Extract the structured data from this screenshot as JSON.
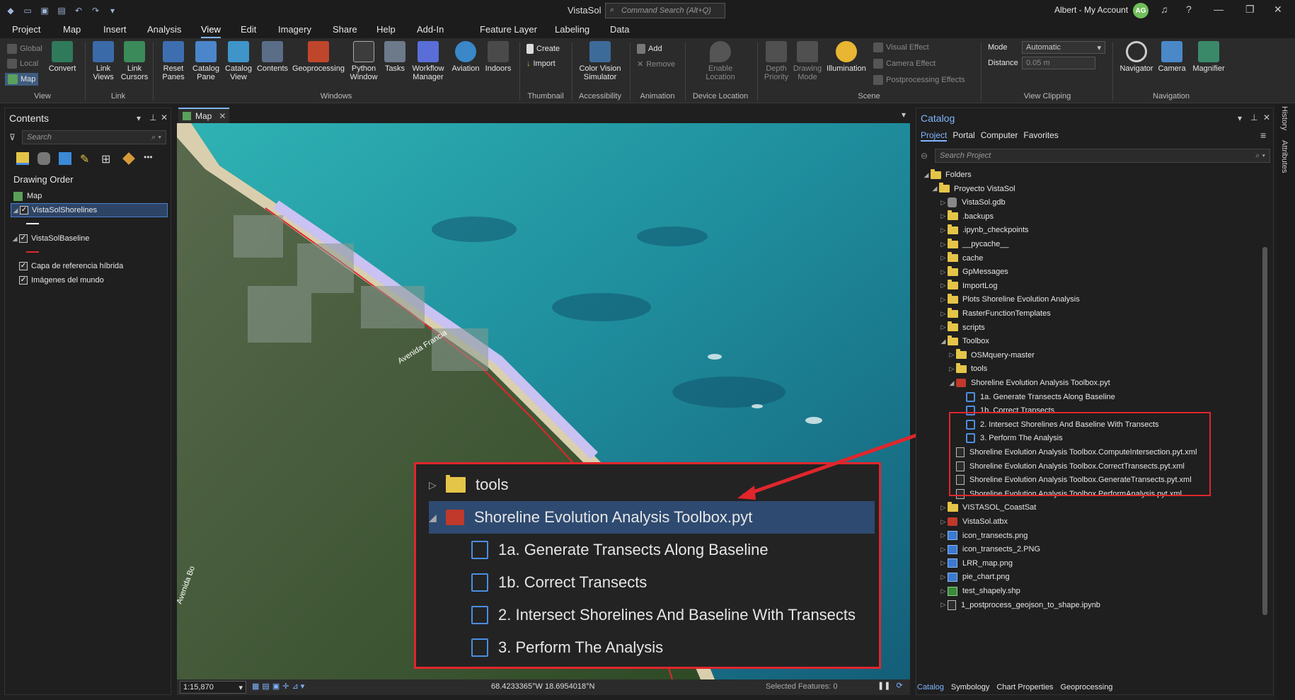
{
  "title": {
    "app_title": "VistaSol",
    "command_search_placeholder": "Command Search (Alt+Q)",
    "account": "Albert - My Account",
    "avatar_initials": "AG"
  },
  "ribbon_tabs": [
    "Project",
    "Map",
    "Insert",
    "Analysis",
    "View",
    "Edit",
    "Imagery",
    "Share",
    "Help",
    "Add-In"
  ],
  "active_tab": "View",
  "context_tabs": {
    "group": "Feature Layer",
    "tabs": [
      "Feature Layer",
      "Labeling",
      "Data"
    ]
  },
  "ribbon": {
    "view_group": {
      "label": "View",
      "items": [
        "Global",
        "Local",
        "Map"
      ]
    },
    "convert": "Convert",
    "link_group": {
      "label": "Link",
      "link_views": "Link Views",
      "link_cursors": "Link Cursors"
    },
    "windows_group": {
      "label": "Windows",
      "items": [
        "Reset Panes",
        "Catalog Pane",
        "Catalog View",
        "Contents",
        "Geoprocessing",
        "Python Window",
        "Tasks",
        "Workflow Manager",
        "Aviation",
        "Indoors"
      ]
    },
    "thumbnail_group": {
      "label": "Thumbnail",
      "create": "Create",
      "import": "Import"
    },
    "accessibility_group": {
      "label": "Accessibility",
      "color_vision": "Color Vision Simulator"
    },
    "animation_group": {
      "label": "Animation",
      "add": "Add",
      "remove": "Remove"
    },
    "device_location_group": {
      "label": "Device Location",
      "enable": "Enable Location"
    },
    "scene_group": {
      "label": "Scene",
      "depth": "Depth Priority",
      "drawing_mode": "Drawing Mode",
      "illumination": "Illumination",
      "visual_effect": "Visual Effect",
      "camera_effect": "Camera Effect",
      "postprocessing": "Postprocessing Effects"
    },
    "view_clipping_group": {
      "label": "View Clipping",
      "mode_label": "Mode",
      "mode_value": "Automatic",
      "distance_label": "Distance",
      "distance_value": "0.05 m"
    },
    "navigation_group": {
      "label": "Navigation",
      "items": [
        "Navigator",
        "Camera",
        "Magnifier"
      ]
    }
  },
  "contents": {
    "title": "Contents",
    "search_placeholder": "Search",
    "drawing_order": "Drawing Order",
    "map_label": "Map",
    "layers": [
      "VistaSolShorelines",
      "VistaSolBaseline",
      "Capa de referencia híbrida",
      "Imágenes del mundo"
    ]
  },
  "map": {
    "tab_label": "Map",
    "road_label": "Avenida Francia",
    "road_label_2": "Avenida Bo",
    "scale": "1:15,870",
    "coordinates": "68.4233365°W 18.6954018°N",
    "selected_features": "Selected Features: 0",
    "colors": {
      "ocean": "#2aa0a8",
      "land": "#3d5a2e",
      "shoreline": "#c9c2f2",
      "baseline": "#e0262c"
    }
  },
  "zoom_callout": {
    "tools": "tools",
    "toolbox": "Shoreline Evolution Analysis Toolbox.pyt",
    "scripts": [
      "1a. Generate Transects Along Baseline",
      "1b. Correct Transects",
      "2. Intersect Shorelines And Baseline With Transects",
      "3. Perform The Analysis"
    ]
  },
  "catalog": {
    "title": "Catalog",
    "tabs": [
      "Project",
      "Portal",
      "Computer",
      "Favorites"
    ],
    "search_placeholder": "Search Project",
    "tree": {
      "folders": "Folders",
      "project_folder": "Proyecto VistaSol",
      "items_a": [
        "VistaSol.gdb",
        ".backups",
        ".ipynb_checkpoints",
        "__pycache__",
        "cache",
        "GpMessages",
        "ImportLog",
        "Plots Shoreline Evolution Analysis",
        "RasterFunctionTemplates",
        "scripts",
        "Toolbox"
      ],
      "toolbox_children": [
        "OSMquery-master",
        "tools"
      ],
      "toolbox_file": "Shoreline Evolution Analysis Toolbox.pyt",
      "scripts": [
        "1a. Generate Transects Along Baseline",
        "1b. Correct Transects",
        "2. Intersect Shorelines And Baseline With Transects",
        "3. Perform The Analysis"
      ],
      "xml_files": [
        "Shoreline Evolution Analysis Toolbox.ComputeIntersection.pyt.xml",
        "Shoreline Evolution Analysis Toolbox.CorrectTransects.pyt.xml",
        "Shoreline Evolution Analysis Toolbox.GenerateTransects.pyt.xml",
        "Shoreline Evolution Analysis Toolbox.PerformAnalysis.pyt.xml"
      ],
      "items_b": [
        "VISTASOL_CoastSat",
        "VistaSol.atbx",
        "icon_transects.png",
        "icon_transects_2.PNG",
        "LRR_map.png",
        "pie_chart.png",
        "test_shapely.shp",
        "1_postprocess_geojson_to_shape.ipynb"
      ]
    },
    "bottom_tabs": [
      "Catalog",
      "Symbology",
      "Chart Properties",
      "Geoprocessing"
    ]
  },
  "side_rail": [
    "History",
    "Attributes"
  ]
}
